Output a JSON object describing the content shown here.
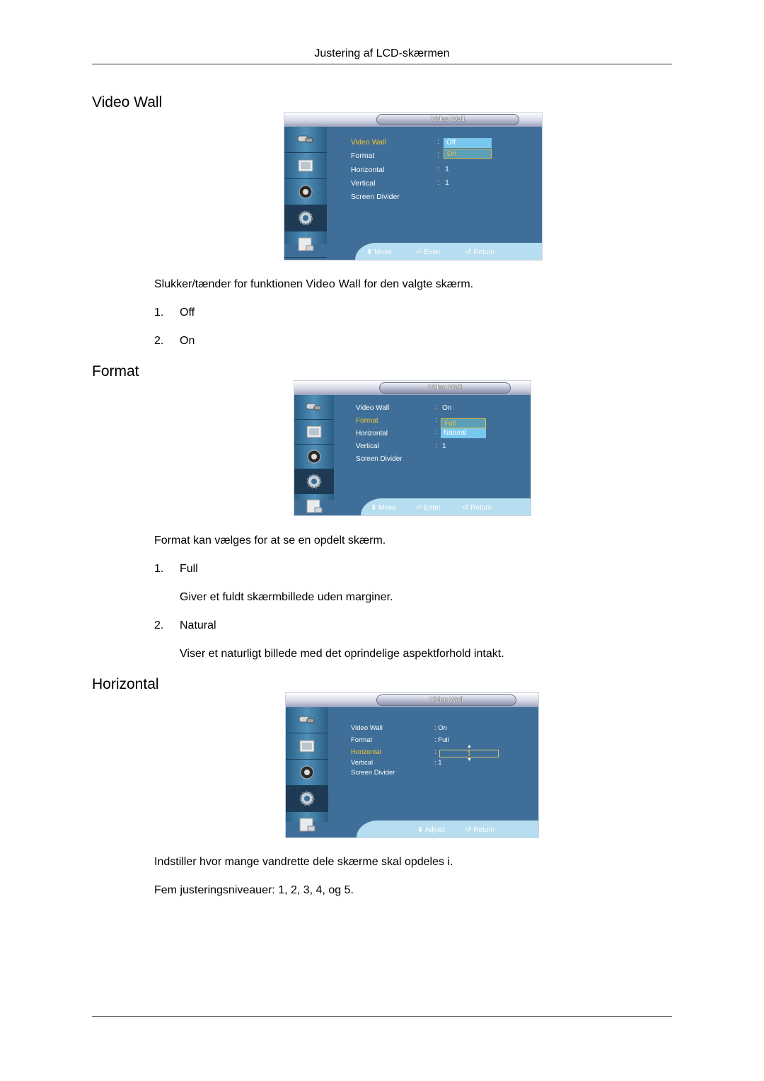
{
  "header": {
    "title": "Justering af LCD-skærmen"
  },
  "sections": [
    {
      "heading": "Video Wall",
      "osd": {
        "title": "Video Wall",
        "sidebar_icons": [
          "input-icon",
          "picture-icon",
          "sound-icon",
          "setup-gear-icon",
          "multi-control-icon"
        ],
        "active_icon_index": 3,
        "rows": [
          {
            "label": "Video Wall",
            "value": ""
          },
          {
            "label": "Format",
            "value": ""
          },
          {
            "label": "Horizontal",
            "value": "1"
          },
          {
            "label": "Vertical",
            "value": "1"
          },
          {
            "label": "Screen Divider",
            "value": ""
          }
        ],
        "selected_row": "Video Wall",
        "dropdown_options": [
          "Off",
          "On"
        ],
        "highlighted_option": "On",
        "footer": [
          {
            "icon": "up-down-icon",
            "label": "Move"
          },
          {
            "icon": "enter-icon",
            "label": "Enter"
          },
          {
            "icon": "return-icon",
            "label": "Return"
          }
        ]
      },
      "description_pre": "Slukker/tænder for funktionen ",
      "description_bold": "Video Wall",
      "description_post": " for den valgte skærm.",
      "items": [
        {
          "num": "1.",
          "label": "Off"
        },
        {
          "num": "2.",
          "label": "On"
        }
      ]
    },
    {
      "heading": "Format",
      "osd": {
        "title": "Video Wall",
        "rows": [
          {
            "label": "Video Wall",
            "value": "On"
          },
          {
            "label": "Format",
            "value": ""
          },
          {
            "label": "Horizontal",
            "value": ""
          },
          {
            "label": "Vertical",
            "value": "1"
          },
          {
            "label": "Screen Divider",
            "value": ""
          }
        ],
        "selected_row": "Format",
        "dropdown_options": [
          "Full",
          "Natural"
        ],
        "highlighted_option": "Full",
        "footer": [
          {
            "icon": "up-down-icon",
            "label": "Move"
          },
          {
            "icon": "enter-icon",
            "label": "Enter"
          },
          {
            "icon": "return-icon",
            "label": "Return"
          }
        ]
      },
      "description_bold": "Format",
      "description_post": " kan vælges for at se en opdelt skærm.",
      "items": [
        {
          "num": "1.",
          "label": "Full",
          "detail": "Giver et fuldt skærmbillede uden marginer."
        },
        {
          "num": "2.",
          "label": "Natural",
          "detail": "Viser et naturligt billede med det oprindelige aspektforhold intakt."
        }
      ]
    },
    {
      "heading": "Horizontal",
      "osd": {
        "title": "Video Wall",
        "rows": [
          {
            "label": "Video Wall",
            "value": ": On"
          },
          {
            "label": "Format",
            "value": ": Full"
          },
          {
            "label": "Horizontal",
            "value": ":"
          },
          {
            "label": "Vertical",
            "value": ": 1"
          },
          {
            "label": "Screen Divider",
            "value": ""
          }
        ],
        "selected_row": "Horizontal",
        "spinner_value": "1",
        "footer": [
          {
            "icon": "up-down-icon",
            "label": "Adjust"
          },
          {
            "icon": "return-icon",
            "label": "Return"
          }
        ]
      },
      "lines": [
        "Indstiller hvor mange vandrette dele skærme skal opdeles i.",
        "Fem justeringsniveauer: 1, 2, 3, 4, og 5."
      ]
    }
  ]
}
